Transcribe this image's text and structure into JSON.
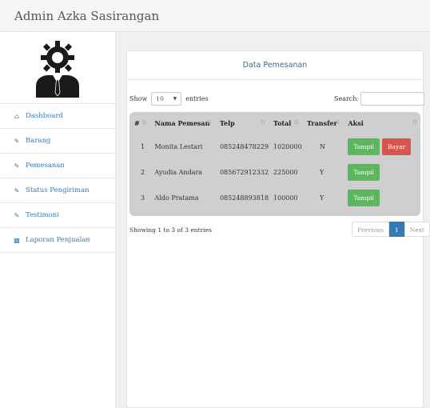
{
  "header": {
    "brand": "Admin Azka Sasirangan"
  },
  "sidebar": {
    "items": [
      {
        "label": "Dashboard",
        "icon": "home-icon"
      },
      {
        "label": "Barang",
        "icon": "edit-icon"
      },
      {
        "label": "Pemesanan",
        "icon": "edit-icon"
      },
      {
        "label": "Status Pengiriman",
        "icon": "edit-icon"
      },
      {
        "label": "Testimoni",
        "icon": "edit-icon"
      },
      {
        "label": "Laporan Penjualan",
        "icon": "bar-chart-icon"
      }
    ]
  },
  "panel": {
    "title": "Data Pemesanan"
  },
  "controls": {
    "show_label": "Show",
    "entries_value": "10",
    "entries_label": "entries",
    "search_label": "Search:"
  },
  "table": {
    "columns": [
      "#",
      "Nama Pemesan",
      "Telp",
      "Total",
      "Transfer",
      "Aksi"
    ],
    "rows": [
      {
        "no": "1",
        "nama": "Monita Lestari",
        "telp": "085248478229",
        "total": "1020000",
        "transfer": "N",
        "actions": [
          "Tampil",
          "Bayar"
        ]
      },
      {
        "no": "2",
        "nama": "Ayudia Andara",
        "telp": "085672912332",
        "total": "225000",
        "transfer": "Y",
        "actions": [
          "Tampil"
        ]
      },
      {
        "no": "3",
        "nama": "Aldo Pratama",
        "telp": "085248893818",
        "total": "100000",
        "transfer": "Y",
        "actions": [
          "Tampil"
        ]
      }
    ]
  },
  "footer": {
    "info": "Showing 1 to 3 of 3 entries",
    "pagination": {
      "previous": "Previous",
      "current": "1",
      "next": "Next"
    }
  },
  "colors": {
    "accent": "#337ab7",
    "success": "#5cb85c",
    "danger": "#d9534f",
    "table_bg": "#cfcfcf"
  }
}
